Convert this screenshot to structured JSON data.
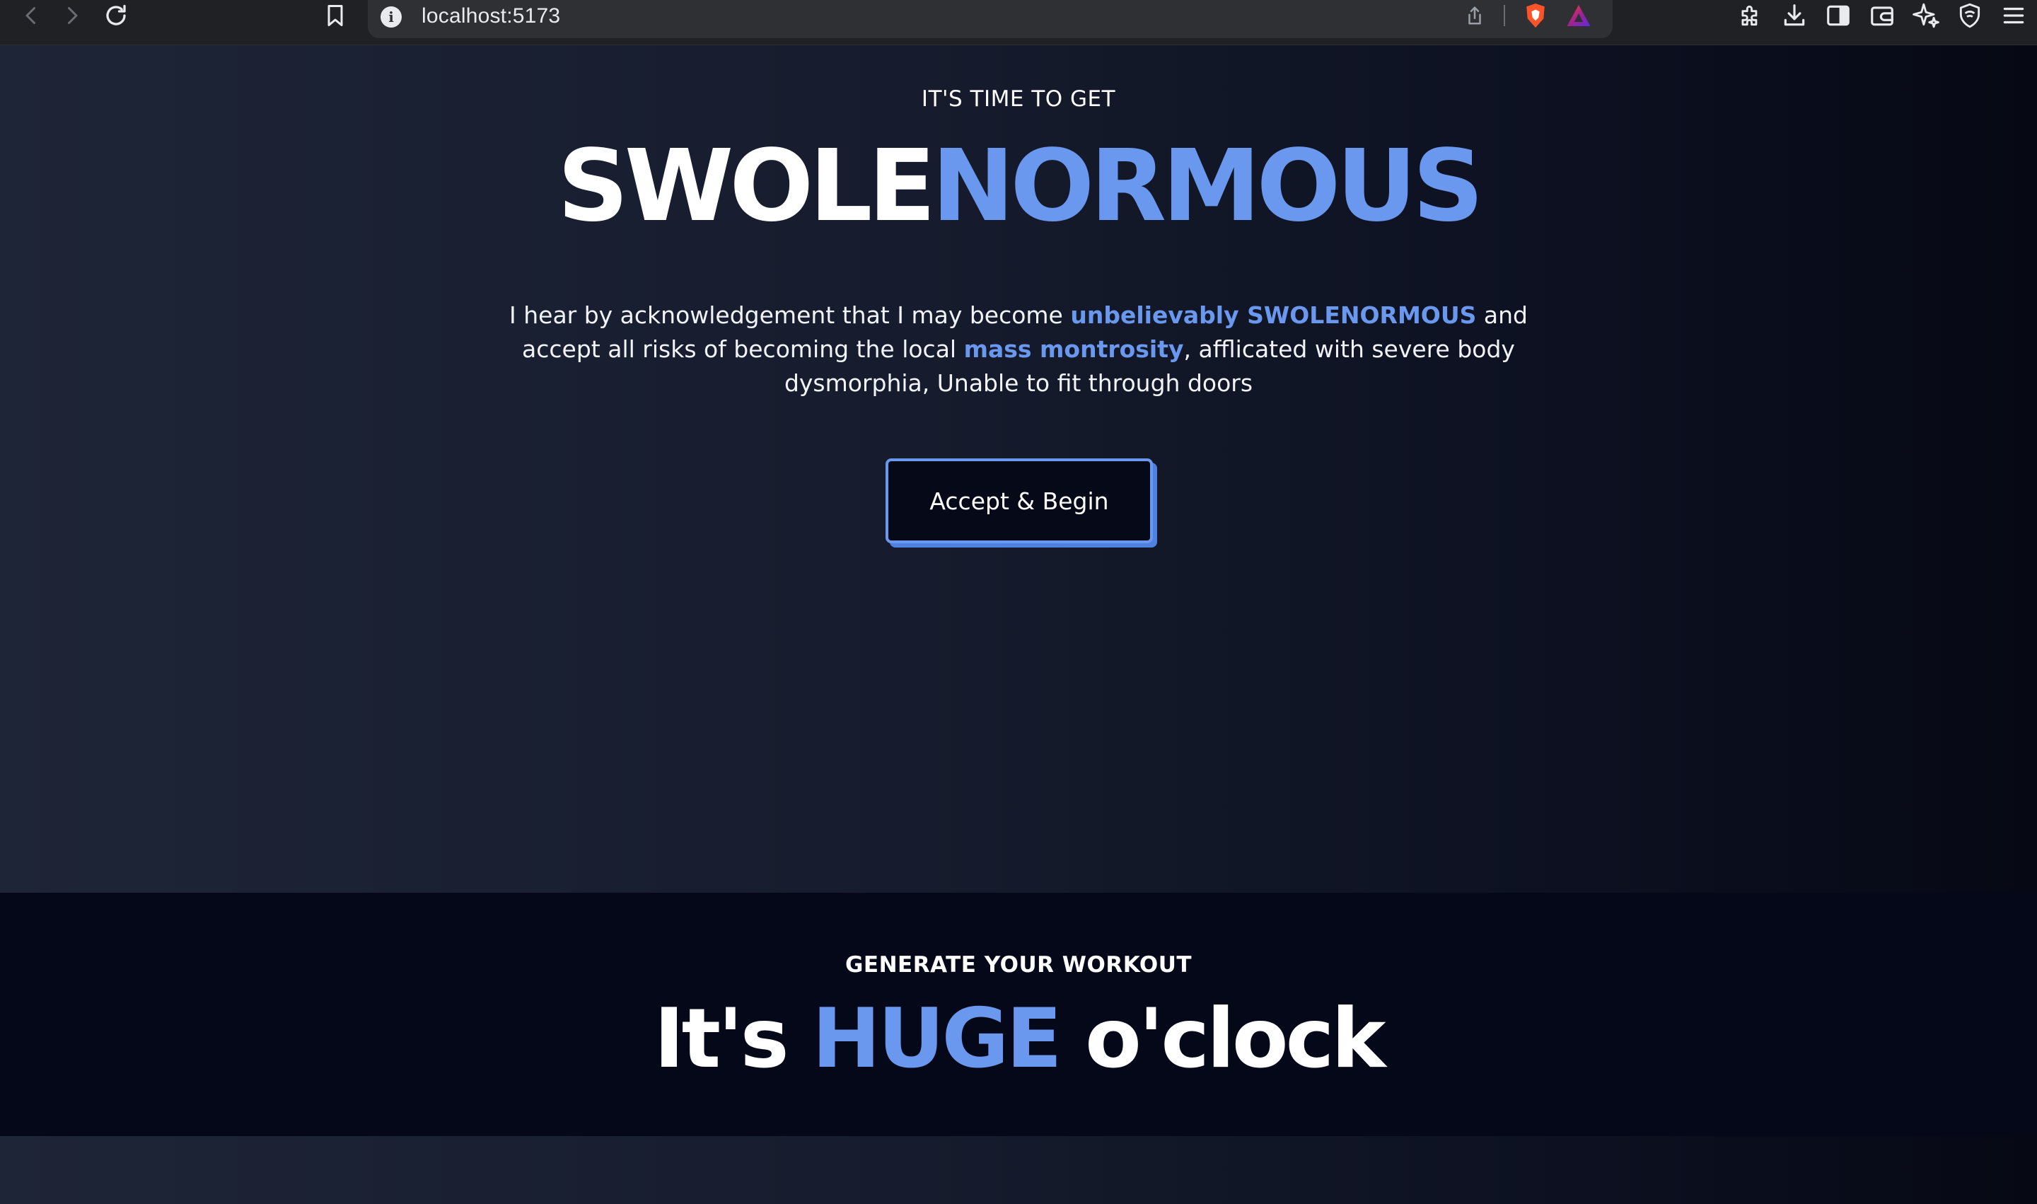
{
  "browser": {
    "url": "localhost:5173",
    "info_glyph": "i",
    "icons": [
      "back-icon",
      "forward-icon",
      "reload-icon",
      "bookmark-icon",
      "info-icon",
      "share-icon",
      "brave-shields-icon",
      "brave-rewards-icon",
      "extensions-icon",
      "download-icon",
      "sidebar-icon",
      "wallet-icon",
      "leo-ai-icon",
      "vpn-shield-icon",
      "menu-icon"
    ]
  },
  "hero": {
    "eyebrow": "IT'S TIME TO GET",
    "title_part1": "SWOLE",
    "title_part2": "NORMOUS",
    "text_1": "I hear by acknowledgement that I may become ",
    "highlight_1": "unbelievably SWOLENORMOUS",
    "text_2": " and accept all risks of becoming the local ",
    "highlight_2": "mass montrosity",
    "text_3": ", afflicated with severe body dysmorphia, Unable to fit through doors",
    "button_label": "Accept & Begin"
  },
  "workout": {
    "eyebrow": "GENERATE YOUR WORKOUT",
    "title_part1": "It's ",
    "title_part2": "HUGE",
    "title_part3": " o'clock"
  },
  "colors": {
    "accent": "#6a98ee",
    "hero_bg_left": "#1e2537",
    "hero_bg_right": "#060914",
    "section_dark": "#040818",
    "button_bg": "#060a18"
  }
}
